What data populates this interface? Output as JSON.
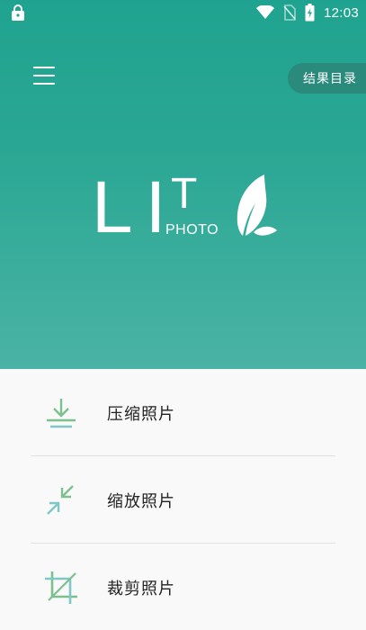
{
  "status_bar": {
    "time": "12:03",
    "icons": [
      "lock-icon",
      "wifi-icon",
      "no-sim-icon",
      "battery-charging-icon"
    ]
  },
  "header": {
    "menu_icon": "menu-icon",
    "results_button": "结果目录"
  },
  "logo": {
    "li": "LI",
    "t": "T",
    "photo": "PHOTO",
    "icon": "feather-icon"
  },
  "menu": {
    "items": [
      {
        "label": "压缩照片",
        "icon": "compress-download-icon"
      },
      {
        "label": "缩放照片",
        "icon": "shrink-arrows-icon"
      },
      {
        "label": "裁剪照片",
        "icon": "crop-icon"
      }
    ]
  },
  "colors": {
    "hero_top": "#1fa390",
    "hero_bottom": "#4ab3a5",
    "results_button_bg": "#2a8a7c",
    "icon_green": "#7cc08e",
    "icon_teal": "#7ec8c5"
  }
}
